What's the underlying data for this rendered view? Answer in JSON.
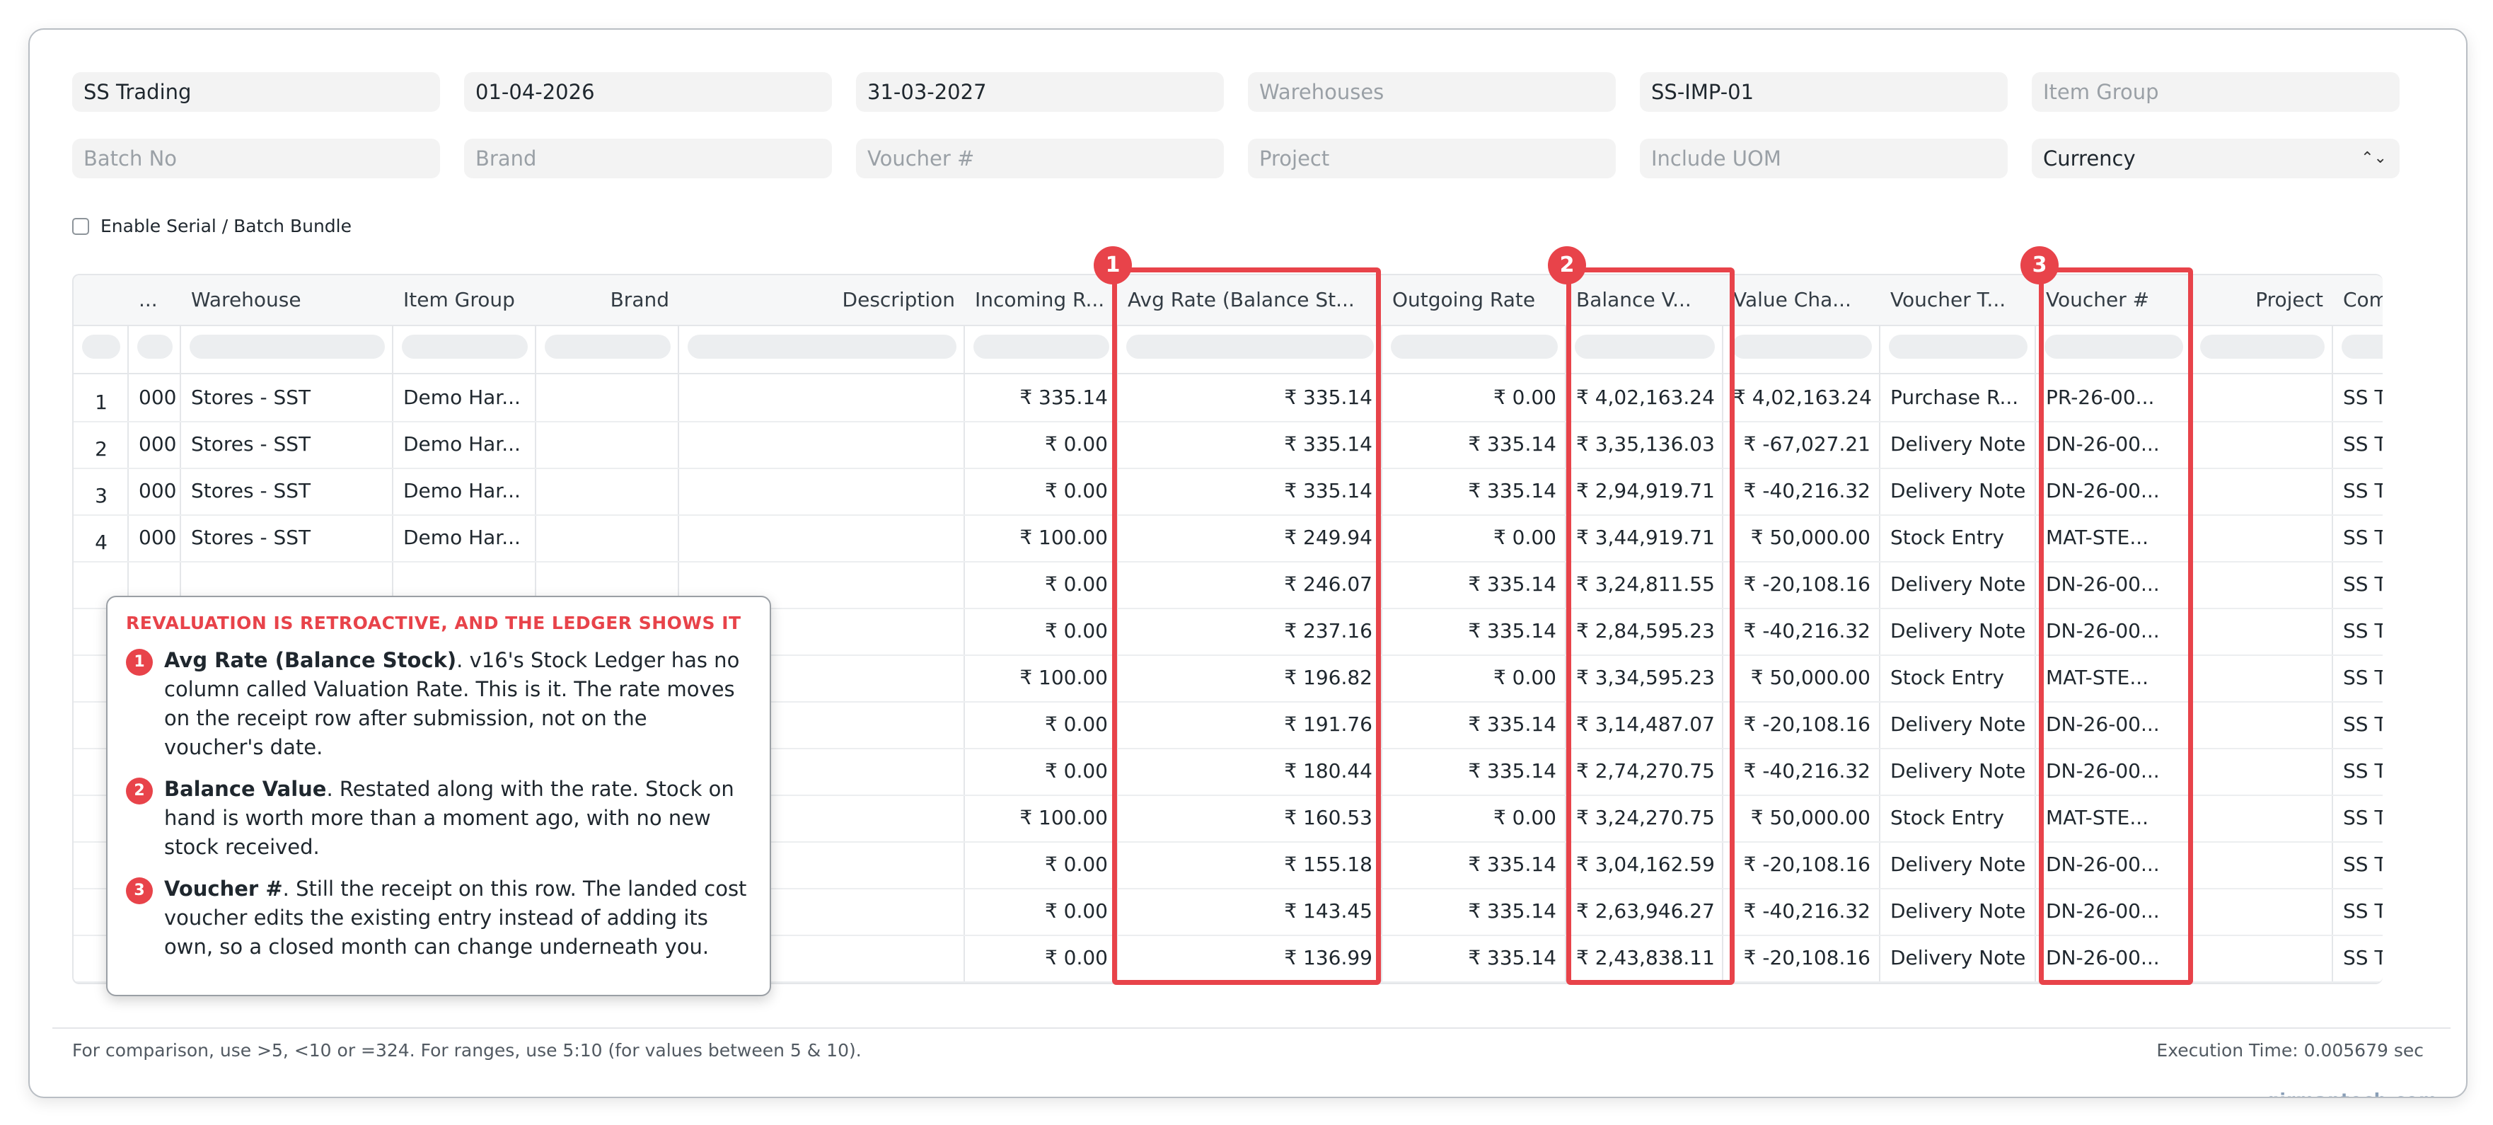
{
  "filters": {
    "row1": [
      "SS Trading",
      "01-04-2026",
      "31-03-2027",
      "Warehouses",
      "SS-IMP-01",
      "Item Group"
    ],
    "row1_placeholder": [
      false,
      false,
      false,
      true,
      false,
      true
    ],
    "row2": [
      "Batch No",
      "Brand",
      "Voucher #",
      "Project",
      "Include UOM",
      "Currency"
    ],
    "row2_placeholder": [
      true,
      true,
      true,
      true,
      true,
      false
    ],
    "currency_caret": "⌃⌄"
  },
  "checkbox_label": "Enable Serial / Batch Bundle",
  "columns": {
    "col0": "...",
    "warehouse": "Warehouse",
    "item_group": "Item Group",
    "brand": "Brand",
    "description": "Description",
    "incoming_rate": "Incoming R...",
    "avg_rate": "Avg Rate (Balance St...",
    "outgoing_rate": "Outgoing Rate",
    "balance_value": "Balance V...",
    "value_change": "Value Cha...",
    "voucher_type": "Voucher T...",
    "voucher_no": "Voucher #",
    "project": "Project",
    "company": "Company"
  },
  "rows": [
    {
      "n": "1",
      "c0": "000",
      "wh": "Stores - SST",
      "ig": "Demo Har...",
      "in": "₹ 335.14",
      "avg": "₹ 335.14",
      "out": "₹ 0.00",
      "bal": "₹ 4,02,163.24",
      "chg": "₹ 4,02,163.24",
      "vt": "Purchase R...",
      "vn": "PR-26-00...",
      "co": "SS Tradi"
    },
    {
      "n": "2",
      "c0": "000",
      "wh": "Stores - SST",
      "ig": "Demo Har...",
      "in": "₹ 0.00",
      "avg": "₹ 335.14",
      "out": "₹ 335.14",
      "bal": "₹ 3,35,136.03",
      "chg": "₹ -67,027.21",
      "vt": "Delivery Note",
      "vn": "DN-26-00...",
      "co": "SS Tradi"
    },
    {
      "n": "3",
      "c0": "000",
      "wh": "Stores - SST",
      "ig": "Demo Har...",
      "in": "₹ 0.00",
      "avg": "₹ 335.14",
      "out": "₹ 335.14",
      "bal": "₹ 2,94,919.71",
      "chg": "₹ -40,216.32",
      "vt": "Delivery Note",
      "vn": "DN-26-00...",
      "co": "SS Tradi"
    },
    {
      "n": "4",
      "c0": "000",
      "wh": "Stores - SST",
      "ig": "Demo Har...",
      "in": "₹ 100.00",
      "avg": "₹ 249.94",
      "out": "₹ 0.00",
      "bal": "₹ 3,44,919.71",
      "chg": "₹ 50,000.00",
      "vt": "Stock Entry",
      "vn": "MAT-STE...",
      "co": "SS Tradi"
    },
    {
      "n": "",
      "c0": "",
      "wh": "",
      "ig": "",
      "in": "₹ 0.00",
      "avg": "₹ 246.07",
      "out": "₹ 335.14",
      "bal": "₹ 3,24,811.55",
      "chg": "₹ -20,108.16",
      "vt": "Delivery Note",
      "vn": "DN-26-00...",
      "co": "SS Tradi"
    },
    {
      "n": "",
      "c0": "",
      "wh": "",
      "ig": "",
      "in": "₹ 0.00",
      "avg": "₹ 237.16",
      "out": "₹ 335.14",
      "bal": "₹ 2,84,595.23",
      "chg": "₹ -40,216.32",
      "vt": "Delivery Note",
      "vn": "DN-26-00...",
      "co": "SS Tradi"
    },
    {
      "n": "",
      "c0": "",
      "wh": "",
      "ig": "",
      "in": "₹ 100.00",
      "avg": "₹ 196.82",
      "out": "₹ 0.00",
      "bal": "₹ 3,34,595.23",
      "chg": "₹ 50,000.00",
      "vt": "Stock Entry",
      "vn": "MAT-STE...",
      "co": "SS Tradi"
    },
    {
      "n": "",
      "c0": "",
      "wh": "",
      "ig": "",
      "in": "₹ 0.00",
      "avg": "₹ 191.76",
      "out": "₹ 335.14",
      "bal": "₹ 3,14,487.07",
      "chg": "₹ -20,108.16",
      "vt": "Delivery Note",
      "vn": "DN-26-00...",
      "co": "SS Tradi"
    },
    {
      "n": "",
      "c0": "",
      "wh": "",
      "ig": "",
      "in": "₹ 0.00",
      "avg": "₹ 180.44",
      "out": "₹ 335.14",
      "bal": "₹ 2,74,270.75",
      "chg": "₹ -40,216.32",
      "vt": "Delivery Note",
      "vn": "DN-26-00...",
      "co": "SS Tradi"
    },
    {
      "n": "",
      "c0": "",
      "wh": "",
      "ig": "",
      "in": "₹ 100.00",
      "avg": "₹ 160.53",
      "out": "₹ 0.00",
      "bal": "₹ 3,24,270.75",
      "chg": "₹ 50,000.00",
      "vt": "Stock Entry",
      "vn": "MAT-STE...",
      "co": "SS Tradi"
    },
    {
      "n": "",
      "c0": "",
      "wh": "",
      "ig": "",
      "in": "₹ 0.00",
      "avg": "₹ 155.18",
      "out": "₹ 335.14",
      "bal": "₹ 3,04,162.59",
      "chg": "₹ -20,108.16",
      "vt": "Delivery Note",
      "vn": "DN-26-00...",
      "co": "SS Tradi"
    },
    {
      "n": "",
      "c0": "",
      "wh": "",
      "ig": "",
      "in": "₹ 0.00",
      "avg": "₹ 143.45",
      "out": "₹ 335.14",
      "bal": "₹ 2,63,946.27",
      "chg": "₹ -40,216.32",
      "vt": "Delivery Note",
      "vn": "DN-26-00...",
      "co": "SS Tradi"
    },
    {
      "n": "",
      "c0": "",
      "wh": "",
      "ig": "",
      "in": "₹ 0.00",
      "avg": "₹ 136.99",
      "out": "₹ 335.14",
      "bal": "₹ 2,43,838.11",
      "chg": "₹ -20,108.16",
      "vt": "Delivery Note",
      "vn": "DN-26-00...",
      "co": "SS Tradi"
    }
  ],
  "badges": [
    "1",
    "2",
    "3"
  ],
  "callout": {
    "title": "REVALUATION IS RETROACTIVE, AND THE LEDGER SHOWS IT",
    "items": [
      {
        "num": "1",
        "term": "Avg Rate (Balance Stock)",
        "text": ". v16's Stock Ledger has no column called Valuation Rate. This is it. The rate moves on the receipt row after submission, not on the voucher's date."
      },
      {
        "num": "2",
        "term": "Balance Value",
        "text": ". Restated along with the rate. Stock on hand is worth more than a moment ago, with no new stock received."
      },
      {
        "num": "3",
        "term": "Voucher #",
        "text": ". Still the receipt on this row. The landed cost voucher edits the existing entry instead of adding its own, so a closed month can change underneath you."
      }
    ]
  },
  "footer": {
    "hint": "For comparison, use >5, <10 or =324. For ranges, use 5:10 (for values between 5 & 10).",
    "execution": "Execution Time: 0.005679 sec"
  },
  "watermark": "girmantech.com",
  "colors": {
    "accent": "#e8434a",
    "watermark": "#8a9fb7"
  }
}
